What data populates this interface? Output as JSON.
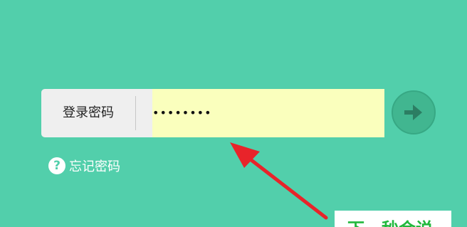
{
  "login": {
    "password_label": "登录密码",
    "password_value": "••••••••",
    "forgot_password": "忘记密码",
    "help_symbol": "?"
  },
  "annotation": {
    "caption": "下一秒会说"
  },
  "icons": {
    "submit": "arrow-right-icon",
    "help": "question-circle-icon"
  },
  "colors": {
    "background": "#52cfab",
    "autofill": "#faffbd",
    "arrow": "#e8242a",
    "caption_text": "#21b83c"
  }
}
